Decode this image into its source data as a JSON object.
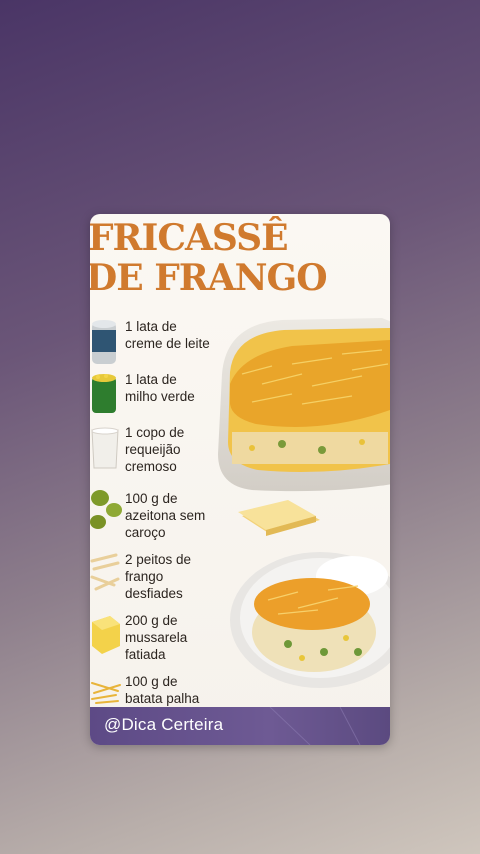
{
  "recipe": {
    "title_line1": "FRICASSÊ",
    "title_line2": "DE FRANGO",
    "ingredients": [
      {
        "text": "1 lata de\ncreme de leite",
        "icon": "can-icon"
      },
      {
        "text": "1 lata de\nmilho verde",
        "icon": "corn-can-icon"
      },
      {
        "text": "1 copo de\nrequeijão\ncremoso",
        "icon": "cream-cheese-cup-icon"
      },
      {
        "text": "100 g de\nazeitona sem\ncaroço",
        "icon": "olives-icon"
      },
      {
        "text": "2 peitos de\nfrango\ndesfiades",
        "icon": "shredded-chicken-icon"
      },
      {
        "text": "200 g de\nmussarela\nfatiada",
        "icon": "cheese-cube-icon"
      },
      {
        "text": "100 g de\nbatata palha",
        "icon": "potato-sticks-icon"
      }
    ],
    "handle": "@Dica Certeira"
  },
  "colors": {
    "title": "#d07a2e",
    "footer": "#5d4a86",
    "cheese": "#f0b23a"
  }
}
